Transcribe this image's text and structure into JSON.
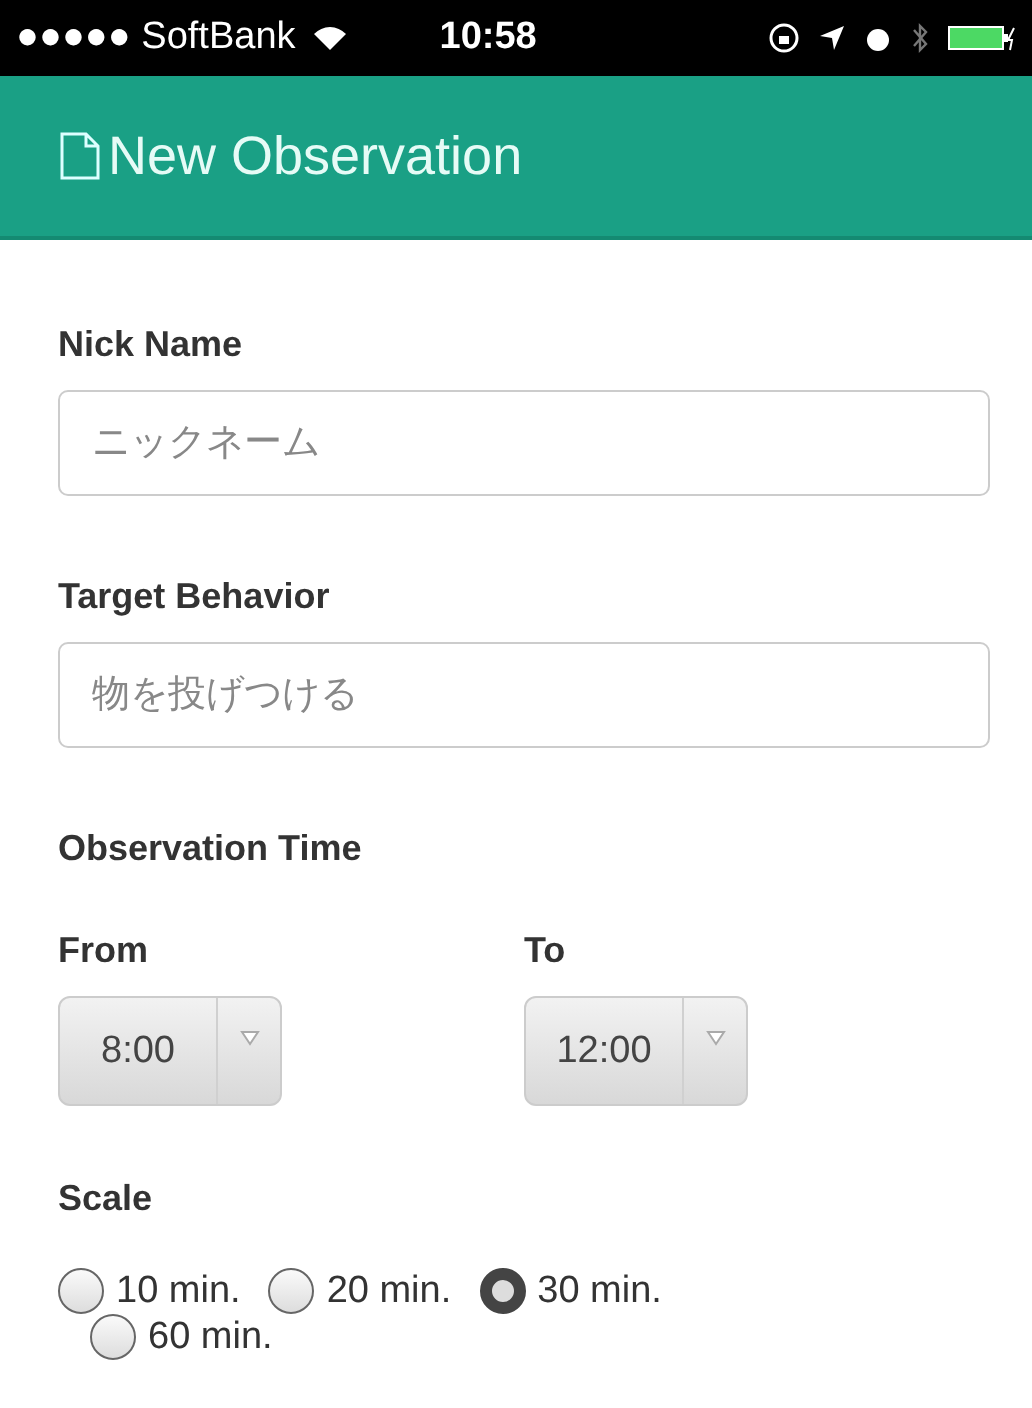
{
  "status_bar": {
    "carrier": "●●●●● SoftBank",
    "time": "10:58"
  },
  "header": {
    "title": "New Observation"
  },
  "fields": [
    {
      "label": "Nick Name",
      "placeholder": "ニックネーム"
    },
    {
      "label": "Target Behavior",
      "placeholder": "物を投げつける"
    }
  ],
  "observation_time": {
    "label": "Observation Time",
    "selects": [
      {
        "label": "From",
        "value": "8:00"
      },
      {
        "label": "To",
        "value": "12:00"
      }
    ]
  },
  "scale": {
    "label": "Scale",
    "options": [
      {
        "label": "10 min.",
        "selected": false
      },
      {
        "label": "20 min.",
        "selected": false
      },
      {
        "label": "30 min.",
        "selected": true
      },
      {
        "label": "60 min.",
        "selected": false
      }
    ]
  }
}
